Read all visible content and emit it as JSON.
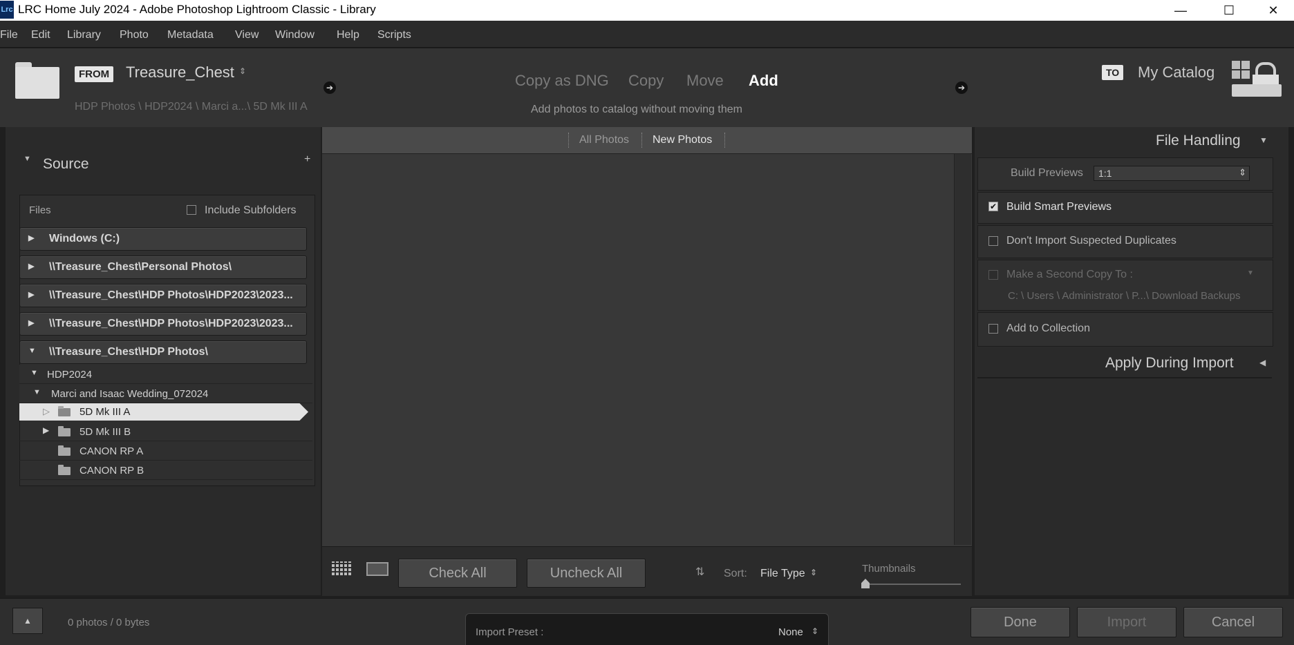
{
  "window": {
    "app_icon": "Lrc",
    "title": "LRC Home July 2024 - Adobe Photoshop Lightroom Classic - Library",
    "minimize": "—",
    "maximize": "☐",
    "close": "✕"
  },
  "menu": [
    "File",
    "Edit",
    "Library",
    "Photo",
    "Metadata",
    "View",
    "Window",
    "Help",
    "Scripts"
  ],
  "header": {
    "from_tag": "FROM",
    "source_name": "Treasure_Chest",
    "source_path": "HDP Photos \\ HDP2024 \\ Marci a...\\ 5D Mk III A",
    "modes": [
      "Copy as DNG",
      "Copy",
      "Move",
      "Add"
    ],
    "active_mode": "Add",
    "mode_description": "Add photos to catalog without moving them",
    "to_tag": "TO",
    "destination": "My Catalog"
  },
  "source_panel": {
    "title": "Source",
    "files_label": "Files",
    "include_subfolders": "Include Subfolders",
    "volumes": [
      "Windows (C:)",
      "\\\\Treasure_Chest\\Personal Photos\\",
      "\\\\Treasure_Chest\\HDP Photos\\HDP2023\\2023...",
      "\\\\Treasure_Chest\\HDP Photos\\HDP2023\\2023...",
      "\\\\Treasure_Chest\\HDP Photos\\"
    ],
    "tree": {
      "year": "HDP2024",
      "event": "Marci and Isaac Wedding_072024",
      "folders": [
        "5D Mk III A",
        "5D Mk III B",
        "CANON RP A",
        "CANON RP B"
      ],
      "selected": "5D Mk III A"
    }
  },
  "center": {
    "tabs": [
      "All Photos",
      "New Photos"
    ],
    "active_tab": "New Photos",
    "check_all": "Check All",
    "uncheck_all": "Uncheck All",
    "sort_label": "Sort:",
    "sort_value": "File Type",
    "thumbnails_label": "Thumbnails"
  },
  "file_handling": {
    "title": "File Handling",
    "build_previews_label": "Build Previews",
    "build_previews_value": "1:1",
    "build_smart_previews": "Build Smart Previews",
    "build_smart_previews_checked": true,
    "dont_import_duplicates": "Don't Import Suspected Duplicates",
    "second_copy": "Make a Second Copy To :",
    "second_copy_path": "C: \\ Users \\ Administrator \\ P...\\ Download Backups",
    "add_to_collection": "Add to Collection",
    "apply_during_import": "Apply During Import"
  },
  "footer": {
    "summary": "0 photos / 0 bytes",
    "import_preset_label": "Import Preset :",
    "import_preset_value": "None",
    "done": "Done",
    "import": "Import",
    "cancel": "Cancel"
  }
}
